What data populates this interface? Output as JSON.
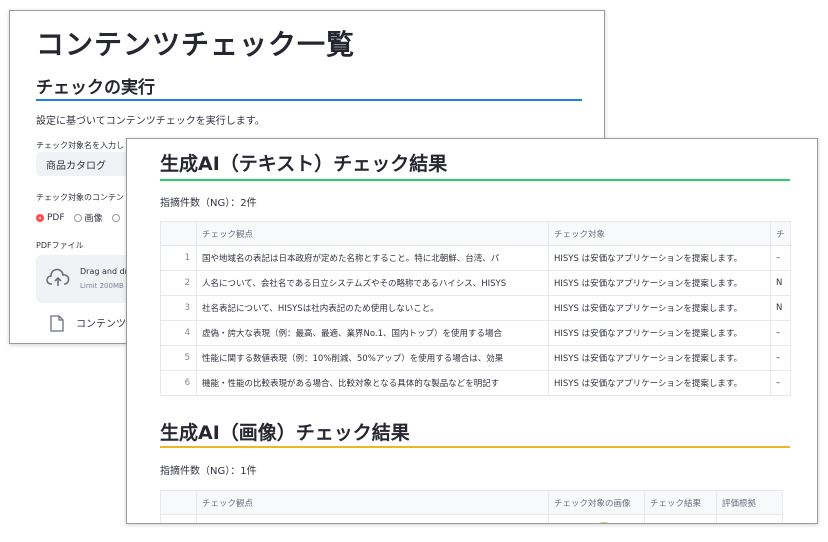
{
  "back_window": {
    "page_title": "コンテンツチェック一覧",
    "section_title": "チェックの実行",
    "description": "設定に基づいてコンテンツチェックを実行します。",
    "target_name_label": "チェック対象名を入力し",
    "target_name_value": "商品カタログ",
    "content_type_label": "チェック対象のコンテン",
    "radio_options": [
      {
        "label": "PDF",
        "selected": true
      },
      {
        "label": "画像",
        "selected": false
      }
    ],
    "pdf_label": "PDFファイル",
    "dropzone": {
      "title": "Drag and dr",
      "limit": "Limit 200MB"
    },
    "file_label": "コンテンツ"
  },
  "front_window": {
    "text_check": {
      "title": "生成AI（テキスト）チェック結果",
      "count_text": "指摘件数（NG）：2件",
      "columns": [
        "チェック観点",
        "チェック対象",
        "チ"
      ],
      "rows": [
        {
          "index": "1",
          "viewpoint": "国や地域名の表記は日本政府が定めた名称とすること。特に北朝鮮、台湾、パ",
          "target": "HISYS は安価なアプリケーションを提案します。",
          "result": "–"
        },
        {
          "index": "2",
          "viewpoint": "人名について、会社名である日立システムズやその略称であるハイシス、HISYS",
          "target": "HISYS は安価なアプリケーションを提案します。",
          "result": "N"
        },
        {
          "index": "3",
          "viewpoint": "社名表記について、HISYSは社内表記のため使用しないこと。",
          "target": "HISYS は安価なアプリケーションを提案します。",
          "result": "N"
        },
        {
          "index": "4",
          "viewpoint": "虚偽・誇大な表現（例：最高、最適、業界No.1、国内トップ）を使用する場合",
          "target": "HISYS は安価なアプリケーションを提案します。",
          "result": "–"
        },
        {
          "index": "5",
          "viewpoint": "性能に関する数値表現（例：10%削減、50%アップ）を使用する場合は、効果",
          "target": "HISYS は安価なアプリケーションを提案します。",
          "result": "–"
        },
        {
          "index": "6",
          "viewpoint": "機能・性能の比較表現がある場合、比較対象となる具体的な製品などを明記す",
          "target": "HISYS は安価なアプリケーションを提案します。",
          "result": "–"
        }
      ]
    },
    "image_check": {
      "title": "生成AI（画像）チェック結果",
      "count_text": "指摘件数（NG）：1件",
      "columns": [
        "チェック観点",
        "チェック対象の画像",
        "チェック結果",
        "評価根拠"
      ]
    }
  },
  "colors": {
    "accent_blue": "#1c83e1",
    "text_rule": "#2ecc71",
    "image_rule": "#f0b429",
    "radio_selected": "#ff4b4b"
  }
}
